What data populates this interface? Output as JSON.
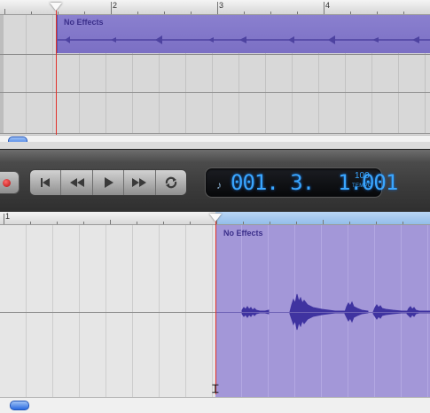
{
  "top_timeline": {
    "ruler_marks": [
      "2",
      "3",
      "4"
    ],
    "region_label": "No Effects"
  },
  "transport": {
    "buttons": [
      {
        "name": "record",
        "icon": "record-icon"
      },
      {
        "name": "go-to-beginning",
        "icon": "go-to-beginning-icon"
      },
      {
        "name": "rewind",
        "icon": "rewind-icon"
      },
      {
        "name": "play",
        "icon": "play-icon"
      },
      {
        "name": "fast-forward",
        "icon": "fast-forward-icon"
      },
      {
        "name": "cycle",
        "icon": "cycle-icon"
      }
    ],
    "lcd": {
      "note_icon": "♪",
      "display": "001. 3.  1.001",
      "tempo_value": "100",
      "tempo_label": "TEMPO"
    }
  },
  "bottom_editor": {
    "ruler_marks": [
      "1"
    ],
    "region_label": "No Effects",
    "cursor_icon": "I-beam-cursor-icon"
  },
  "colors": {
    "region": "#7b6fc4",
    "region_bottom": "#a397d8",
    "playhead": "#e0302a",
    "lcd_text": "#3aa6ff",
    "record": "#b10c0c"
  }
}
